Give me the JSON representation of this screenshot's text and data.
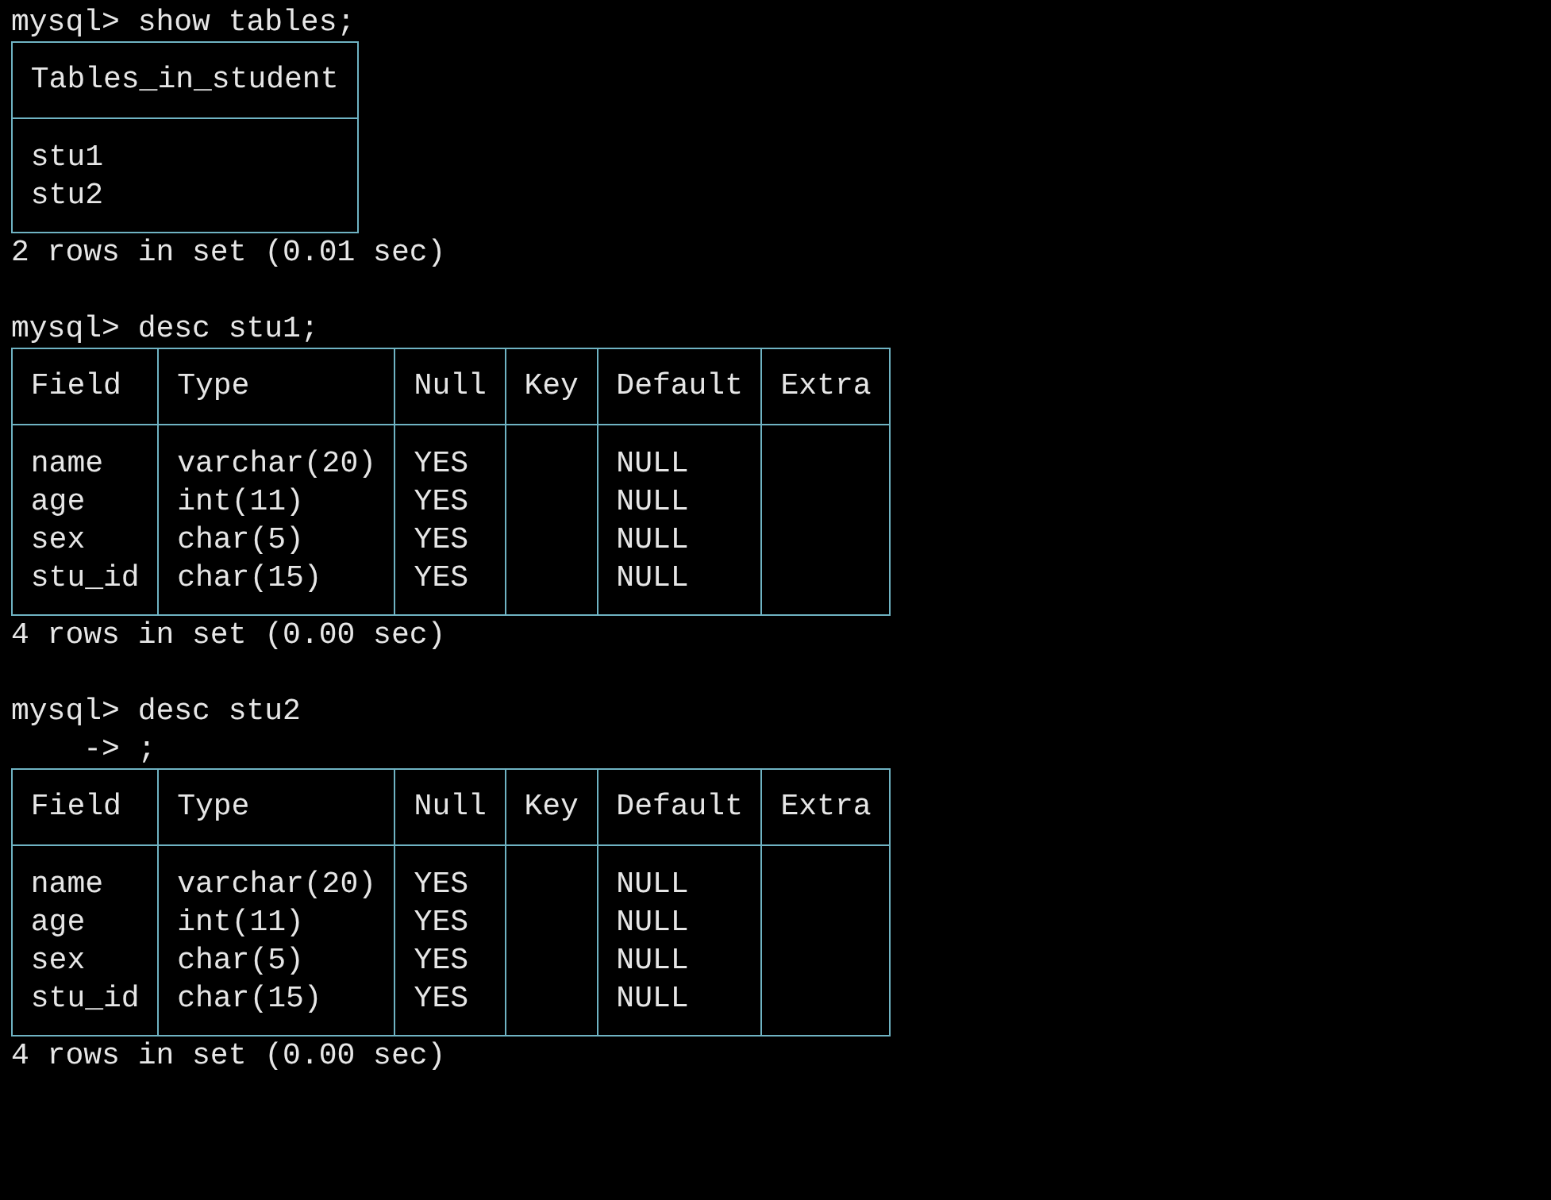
{
  "terminal": {
    "blocks": [
      {
        "prompt": "mysql>",
        "command": "show tables;",
        "table": {
          "columns": [
            "Tables_in_student"
          ],
          "rows": [
            [
              "stu1"
            ],
            [
              "stu2"
            ]
          ]
        },
        "summary": "2 rows in set (0.01 sec)"
      },
      {
        "prompt": "mysql>",
        "command": "desc stu1;",
        "table": {
          "columns": [
            "Field",
            "Type",
            "Null",
            "Key",
            "Default",
            "Extra"
          ],
          "rows": [
            [
              "name",
              "varchar(20)",
              "YES",
              null,
              "NULL",
              null
            ],
            [
              "age",
              "int(11)",
              "YES",
              null,
              "NULL",
              null
            ],
            [
              "sex",
              "char(5)",
              "YES",
              null,
              "NULL",
              null
            ],
            [
              "stu_id",
              "char(15)",
              "YES",
              null,
              "NULL",
              null
            ]
          ]
        },
        "summary": "4 rows in set (0.00 sec)"
      },
      {
        "prompt": "mysql>",
        "command": "desc stu2",
        "continuation": {
          "prompt": "->",
          "command": ";"
        },
        "table": {
          "columns": [
            "Field",
            "Type",
            "Null",
            "Key",
            "Default",
            "Extra"
          ],
          "rows": [
            [
              "name",
              "varchar(20)",
              "YES",
              null,
              "NULL",
              null
            ],
            [
              "age",
              "int(11)",
              "YES",
              null,
              "NULL",
              null
            ],
            [
              "sex",
              "char(5)",
              "YES",
              null,
              "NULL",
              null
            ],
            [
              "stu_id",
              "char(15)",
              "YES",
              null,
              "NULL",
              null
            ]
          ]
        },
        "summary": "4 rows in set (0.00 sec)"
      }
    ]
  }
}
